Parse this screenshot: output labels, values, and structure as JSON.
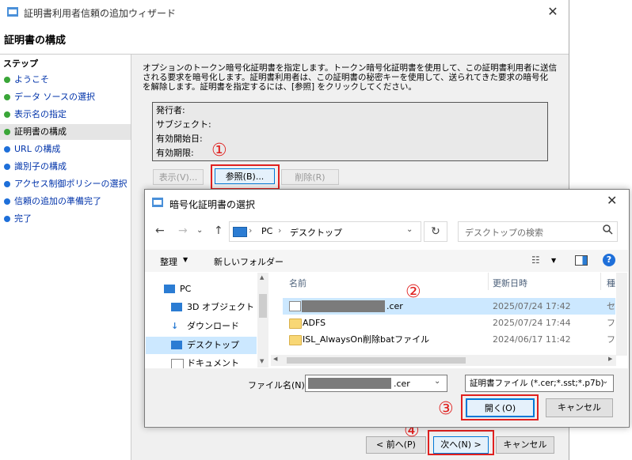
{
  "wizard": {
    "title": "証明書利用者信頼の追加ウィザード",
    "heading": "証明書の構成",
    "steps_title": "ステップ",
    "steps": [
      {
        "label": "ようこそ",
        "state": "done"
      },
      {
        "label": "データ ソースの選択",
        "state": "done"
      },
      {
        "label": "表示名の指定",
        "state": "done"
      },
      {
        "label": "証明書の構成",
        "state": "current"
      },
      {
        "label": "URL の構成",
        "state": "pending"
      },
      {
        "label": "識別子の構成",
        "state": "pending"
      },
      {
        "label": "アクセス制御ポリシーの選択",
        "state": "pending"
      },
      {
        "label": "信頼の追加の準備完了",
        "state": "pending"
      },
      {
        "label": "完了",
        "state": "pending"
      }
    ],
    "instruction_line1": "オプションのトークン暗号化証明書を指定します。トークン暗号化証明書を使用して、この証明書利用者に送信",
    "instruction_line2": "される要求を暗号化します。証明書利用者は、この証明書の秘密キーを使用して、送られてきた要求の暗号化",
    "instruction_line3": "を解除します。証明書を指定するには、[参照] をクリックしてください。",
    "cert_fields": [
      "発行者:",
      "サブジェクト:",
      "有効開始日:",
      "有効期限:"
    ],
    "view_button": "表示(V)...",
    "browse_button": "参照(B)...",
    "delete_button": "削除(R)",
    "back_button": "< 前へ(P)",
    "next_button": "次へ(N) >",
    "cancel_button": "キャンセル"
  },
  "dialog": {
    "title": "暗号化証明書の選択",
    "breadcrumb": [
      "PC",
      "デスクトップ"
    ],
    "search_placeholder": "デスクトップの検索",
    "organize": "整理",
    "new_folder": "新しいフォルダー",
    "tree": [
      {
        "label": "PC",
        "icon": "pc-icon"
      },
      {
        "label": "3D オブジェクト",
        "icon": "3d-objects-icon"
      },
      {
        "label": "ダウンロード",
        "icon": "download-icon"
      },
      {
        "label": "デスクトップ",
        "icon": "desktop-icon"
      },
      {
        "label": "ドキュメント",
        "icon": "document-icon"
      }
    ],
    "columns": {
      "name": "名前",
      "date": "更新日時",
      "type": "種"
    },
    "files": [
      {
        "name": ".cer",
        "date": "2025/07/24 17:42",
        "type": "セ",
        "kind": "cert"
      },
      {
        "name": "ADFS",
        "date": "2025/07/24 17:44",
        "type": "フ",
        "kind": "folder"
      },
      {
        "name": "ISL_AlwaysOn削除batファイル",
        "date": "2024/06/17 11:42",
        "type": "フ",
        "kind": "folder"
      }
    ],
    "filename_label": "ファイル名(N):",
    "filename_value": ".cer",
    "filter_value": "証明書ファイル (*.cer;*.sst;*.p7b)",
    "open_button": "開く(O)",
    "cancel_button": "キャンセル"
  },
  "annotations": [
    "①",
    "②",
    "③",
    "④"
  ],
  "colors": {
    "highlight": "#e0201f",
    "selection": "#cce8ff",
    "done_dot": "#3aa638",
    "pending_dot": "#1e6fd9"
  }
}
